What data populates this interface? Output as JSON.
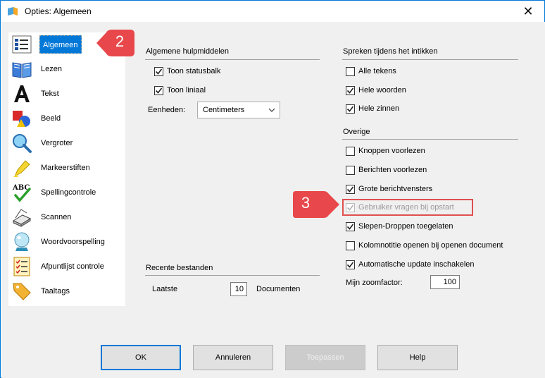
{
  "window": {
    "title": "Opties: Algemeen",
    "close_glyph": "✕"
  },
  "sidebar": {
    "items": [
      {
        "label": "Algemeen",
        "icon": "options-list-icon",
        "active": true
      },
      {
        "label": "Lezen",
        "icon": "book-icon"
      },
      {
        "label": "Tekst",
        "icon": "letter-a-icon"
      },
      {
        "label": "Beeld",
        "icon": "shapes-icon"
      },
      {
        "label": "Vergroter",
        "icon": "magnifier-icon"
      },
      {
        "label": "Markeerstiften",
        "icon": "highlighter-icon"
      },
      {
        "label": "Spellingcontrole",
        "icon": "spellcheck-icon"
      },
      {
        "label": "Scannen",
        "icon": "scanner-icon"
      },
      {
        "label": "Woordvoorspelling",
        "icon": "crystal-ball-icon"
      },
      {
        "label": "Afpuntlijst controle",
        "icon": "checklist-icon"
      },
      {
        "label": "Taaltags",
        "icon": "tag-icon"
      }
    ]
  },
  "hulpmiddelen": {
    "title": "Algemene hulpmiddelen",
    "statusbalk": {
      "label": "Toon statusbalk",
      "checked": true
    },
    "liniaal": {
      "label": "Toon liniaal",
      "checked": true
    },
    "eenheden_label": "Eenheden:",
    "eenheden_value": "Centimeters"
  },
  "spreken": {
    "title": "Spreken tijdens het intikken",
    "items": [
      {
        "label": "Alle tekens",
        "checked": false
      },
      {
        "label": "Hele woorden",
        "checked": true
      },
      {
        "label": "Hele zinnen",
        "checked": true
      }
    ]
  },
  "overige": {
    "title": "Overige",
    "items": [
      {
        "label": "Knoppen voorlezen",
        "checked": false
      },
      {
        "label": "Berichten voorlezen",
        "checked": false
      },
      {
        "label": "Grote berichtvensters",
        "checked": true
      },
      {
        "label": "Gebruiker vragen bij opstart",
        "checked": true,
        "disabled": true
      },
      {
        "label": "Slepen-Droppen toegelaten",
        "checked": true
      },
      {
        "label": "Kolomnotitie openen bij openen document",
        "checked": false
      },
      {
        "label": "Automatische update inschakelen",
        "checked": true
      }
    ],
    "zoom_label": "Mijn zoomfactor:",
    "zoom_value": "100"
  },
  "recente": {
    "title": "Recente bestanden",
    "laatste_label": "Laatste",
    "laatste_value": "10",
    "documenten_label": "Documenten"
  },
  "buttons": {
    "ok": "OK",
    "annuleren": "Annuleren",
    "toepassen": "Toepassen",
    "help": "Help"
  },
  "callouts": {
    "step2": "2",
    "step3": "3"
  },
  "colors": {
    "accent": "#0078d7",
    "callout": "#e8484b",
    "highlight": "#e05050"
  }
}
